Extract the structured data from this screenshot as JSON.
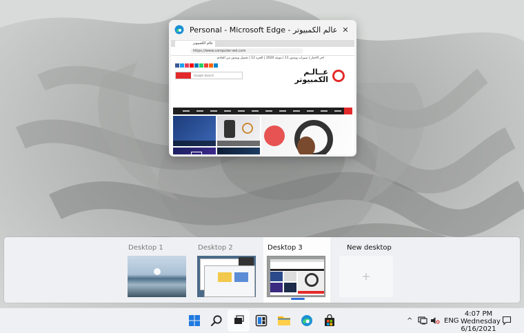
{
  "window_preview": {
    "title": "Personal - Microsoft Edge - عالم الكمبيوتر",
    "close_glyph": "✕",
    "browser": {
      "tab_title": "عالم الكمبيوتر",
      "url": "https://www.computer-wd.com",
      "ticker": "اخر الاخبار | سيزاب ويندوز 11 | موعد 2020 | الجزء 12 | تحميل ويندوز من الخادم",
      "site_logo": "عــالـم الكمبيوتر",
      "search_placeholder": "Google Search"
    }
  },
  "task_view": {
    "desktops": [
      {
        "label": "Desktop 1",
        "active": false
      },
      {
        "label": "Desktop 2",
        "active": false
      },
      {
        "label": "Desktop 3",
        "active": true
      }
    ],
    "new_desktop_label": "New desktop",
    "new_desktop_icon": "plus-icon"
  },
  "taskbar": {
    "apps": [
      "start-icon",
      "search-icon",
      "task-view-icon",
      "widgets-icon",
      "file-explorer-icon",
      "edge-icon",
      "store-icon"
    ],
    "tray": {
      "chevron": "^",
      "language": "ENG",
      "time": "4:07 PM",
      "day": "Wednesday",
      "date": "6/16/2021"
    }
  },
  "colors": {
    "accent": "#2b6cdc",
    "site_red": "#e32a2a",
    "panel": "#eef0f3"
  }
}
